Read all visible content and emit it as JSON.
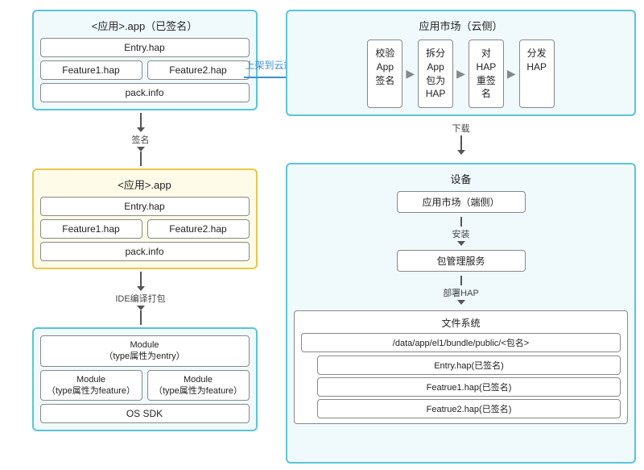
{
  "left": {
    "signed_app": {
      "title": "<应用>.app（已签名）",
      "entry": "Entry.hap",
      "feature1": "Feature1.hap",
      "feature2": "Feature2.hap",
      "packinfo": "pack.info"
    },
    "sign_label": "签名",
    "unsigned_app": {
      "title": "<应用>.app",
      "entry": "Entry.hap",
      "feature1": "Feature1.hap",
      "feature2": "Feature2.hap",
      "packinfo": "pack.info"
    },
    "ide_label": "IDE编译打包",
    "modules": {
      "main": "Module\n（type属性为entry）",
      "main_line1": "Module",
      "main_line2": "（type属性为entry）",
      "left_line1": "Module",
      "left_line2": "（type属性为feature）",
      "right_line1": "Module",
      "right_line2": "（type属性为feature）",
      "sdk": "OS SDK"
    }
  },
  "upload_arrow": {
    "label": "上架到云端"
  },
  "right": {
    "cloud": {
      "title": "应用市场（云侧）",
      "step1_line1": "校验",
      "step1_line2": "App",
      "step1_line3": "签名",
      "step2_line1": "拆分",
      "step2_line2": "App",
      "step2_line3": "包为",
      "step2_line4": "HAP",
      "step3_line1": "对",
      "step3_line2": "HAP",
      "step3_line3": "重签",
      "step3_line4": "名",
      "step4_line1": "分发",
      "step4_line2": "HAP"
    },
    "download_label": "下载",
    "device": {
      "title": "设备",
      "appmarket": "应用市场（端侧）",
      "install_label": "安装",
      "pkgmgr": "包管理服务",
      "deploy_label": "部署HAP",
      "fs_title": "文件系统",
      "fs_path": "/data/app/el1/bundle/public/<包名>",
      "entry": "Entry.hap(已签名)",
      "feature1": "Featrue1.hap(已签名)",
      "feature2": "Featrue2.hap(已签名)"
    }
  }
}
